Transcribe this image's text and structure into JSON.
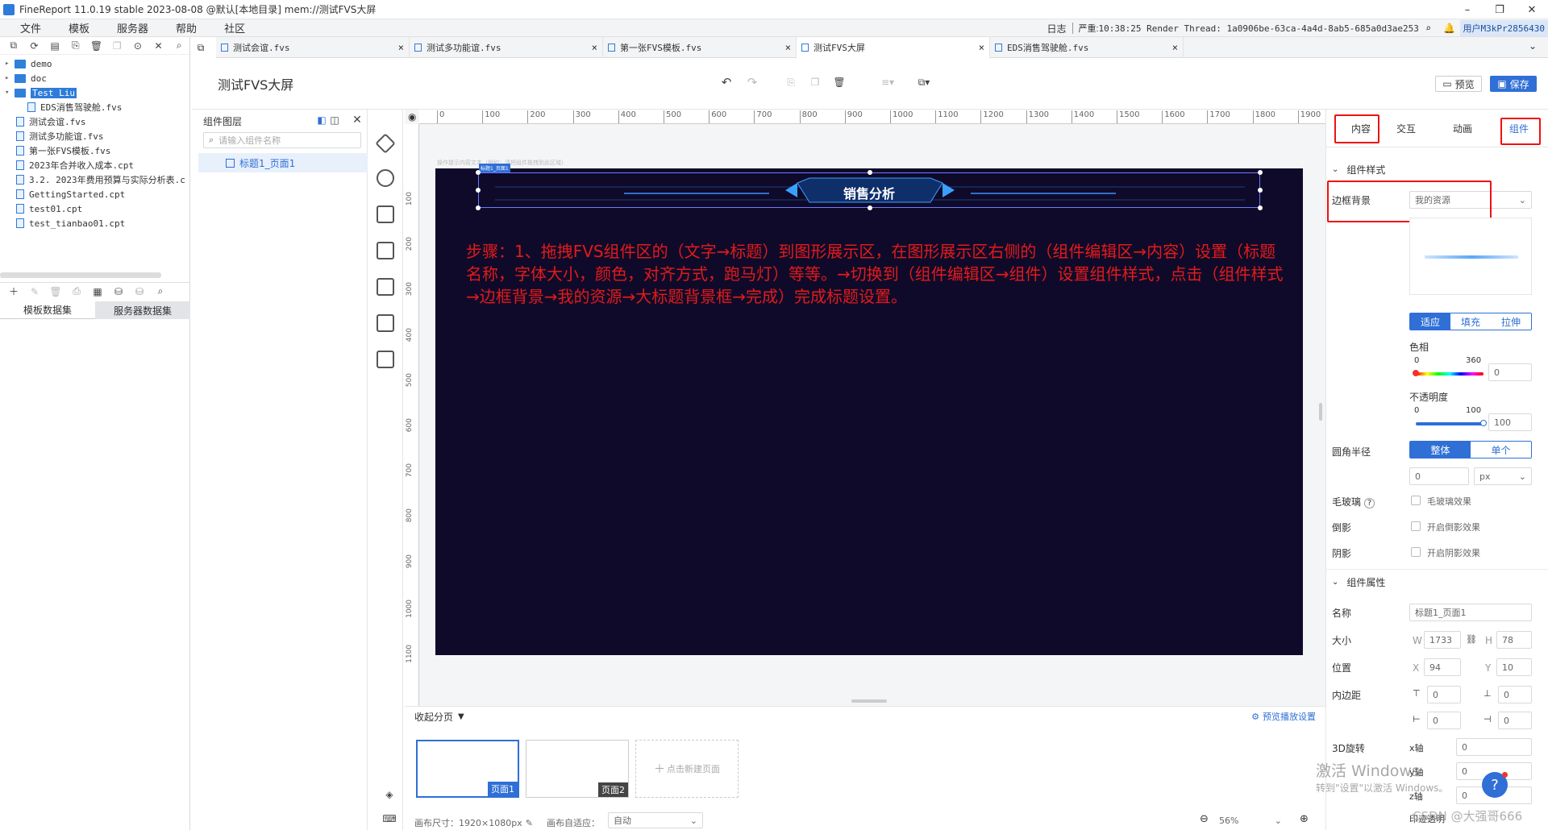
{
  "window": {
    "title": "FineReport 11.0.19 stable 2023-08-08 @默认[本地目录]    mem://测试FVS大屏"
  },
  "menu": [
    "文件",
    "模板",
    "服务器",
    "帮助",
    "社区"
  ],
  "logbar": {
    "log_label": "日志",
    "severe_label": "严重:",
    "message": "10:38:25 Render Thread: 1a0906be-63ca-4a4d-8ab5-685a0d3ae253 ERROR [standard] warning...",
    "user": "用户M3kPr2856430"
  },
  "tree": [
    {
      "label": "demo",
      "type": "folder",
      "indent": 0
    },
    {
      "label": "doc",
      "type": "folder",
      "indent": 0
    },
    {
      "label": "Test Liu",
      "type": "folder",
      "indent": 0,
      "selected": true
    },
    {
      "label": "EDS消售驾驶舱.fvs",
      "type": "file",
      "indent": 2
    },
    {
      "label": "测试会谊.fvs",
      "type": "file",
      "indent": 1
    },
    {
      "label": "测试多功能谊.fvs",
      "type": "file",
      "indent": 1
    },
    {
      "label": "第一张FVS模板.fvs",
      "type": "file",
      "indent": 1
    },
    {
      "label": "2023年合并收入成本.cpt",
      "type": "file",
      "indent": 1
    },
    {
      "label": "3.2. 2023年费用预算与实际分析表.c",
      "type": "file",
      "indent": 1
    },
    {
      "label": "GettingStarted.cpt",
      "type": "file",
      "indent": 1
    },
    {
      "label": "test01.cpt",
      "type": "file",
      "indent": 1
    },
    {
      "label": "test_tianbao01.cpt",
      "type": "file",
      "indent": 1
    }
  ],
  "dataset_tabs": [
    "模板数据集",
    "服务器数据集"
  ],
  "tabs": [
    {
      "label": "测试会谊.fvs",
      "active": false
    },
    {
      "label": "测试多功能谊.fvs",
      "active": false
    },
    {
      "label": "第一张FVS模板.fvs",
      "active": false
    },
    {
      "label": "测试FVS大屏",
      "active": true
    },
    {
      "label": "EDS消售驾驶舱.fvs",
      "active": false
    }
  ],
  "editor": {
    "title": "测试FVS大屏",
    "preview_label": "预览",
    "save_label": "保存"
  },
  "layers": {
    "title": "组件图层",
    "search_placeholder": "请输入组件名称",
    "items": [
      "标题1_页面1"
    ]
  },
  "ruler_h": [
    "0",
    "100",
    "200",
    "300",
    "400",
    "500",
    "600",
    "700",
    "800",
    "900",
    "1000",
    "1100",
    "1200",
    "1300",
    "1400",
    "1500",
    "1600",
    "1700",
    "1800",
    "1900"
  ],
  "ruler_v": [
    "100",
    "200",
    "300",
    "400",
    "500",
    "600",
    "700",
    "800",
    "900",
    "1000",
    "1100"
  ],
  "canvas": {
    "hint": "操作提示内容文本（例如：请把组件拖拽到此区域）",
    "widget_tag": "标题1_页面1",
    "widget_title": "销售分析"
  },
  "annotation": "步骤：1、拖拽FVS组件区的（文字→标题）到图形展示区，在图形展示区右侧的（组件编辑区→内容）设置（标题名称，字体大小，颜色，对齐方式，跑马灯）等等。→切换到（组件编辑区→组件）设置组件样式，点击（组件样式→边框背景→我的资源→大标题背景框→完成）完成标题设置。",
  "right": {
    "tabs": [
      "内容",
      "交互",
      "动画",
      "组件"
    ],
    "section_style": "组件样式",
    "border_bg_label": "边框背景",
    "border_bg_value": "我的资源",
    "fit_options": [
      "适应",
      "填充",
      "拉伸"
    ],
    "hue_label": "色相",
    "hue_min": "0",
    "hue_max": "360",
    "hue_value": "0",
    "opacity_label": "不透明度",
    "opacity_min": "0",
    "opacity_max": "100",
    "opacity_value": "100",
    "radius_label": "圆角半径",
    "radius_modes": [
      "整体",
      "单个"
    ],
    "radius_value": "0",
    "radius_unit": "px",
    "frosted_label": "毛玻璃",
    "frosted_check": "毛玻璃效果",
    "reflect_label": "倒影",
    "reflect_check": "开启倒影效果",
    "shadow_label": "阴影",
    "shadow_check": "开启阴影效果",
    "section_props": "组件属性",
    "name_label": "名称",
    "name_value": "标题1_页面1",
    "size_label": "大小",
    "w_label": "W",
    "w_value": "1733",
    "h_label": "H",
    "h_value": "78",
    "pos_label": "位置",
    "x_label": "X",
    "x_value": "94",
    "y_label": "Y",
    "y_value": "10",
    "padding_label": "内边距",
    "padding_values": [
      "0",
      "0",
      "0",
      "0"
    ],
    "rotate_label": "3D旋转",
    "x_axis": "x轴",
    "y_axis": "y轴",
    "z_axis": "z轴",
    "rotate_values": [
      "0",
      "0",
      "0"
    ],
    "print_label": "印迹透明"
  },
  "bottom": {
    "collapse_label": "收起分页",
    "play_settings": "预览播放设置",
    "pages": [
      "页面1",
      "页面2"
    ],
    "new_page": "点击新建页面",
    "canvas_size": "画布尺寸：1920×1080px",
    "adapt_label": "画布自适应：",
    "adapt_value": "自动",
    "zoom": "56%"
  },
  "watermark": {
    "line1": "激活 Windows",
    "line2": "转到\"设置\"以激活 Windows。",
    "csdn": "CSDN @大强哥666"
  }
}
